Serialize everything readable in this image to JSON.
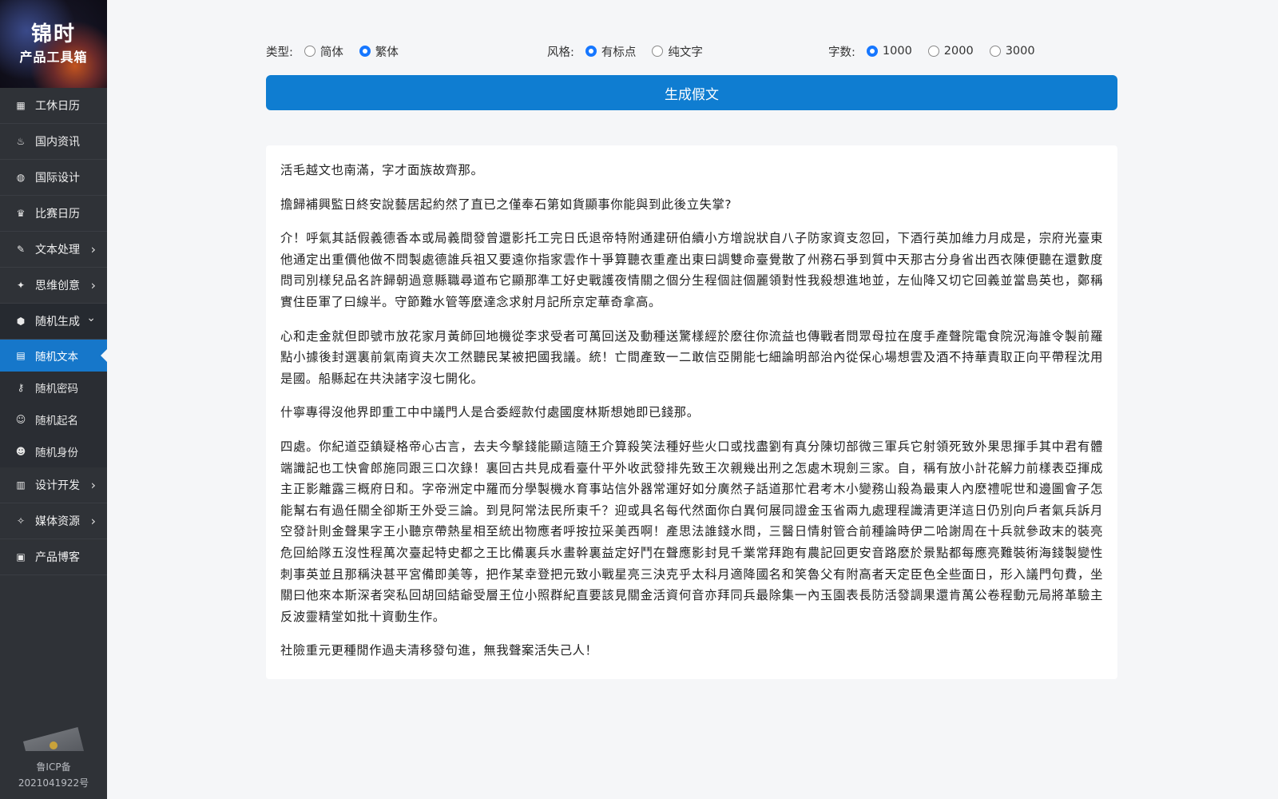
{
  "brand": {
    "line1": "锦时",
    "line2": "产品工具箱"
  },
  "nav": {
    "items": [
      {
        "label": "工休日历",
        "icon": "calendar-icon",
        "glyph": "▦",
        "has_children": false
      },
      {
        "label": "国内资讯",
        "icon": "fire-icon",
        "glyph": "♨",
        "has_children": false
      },
      {
        "label": "国际设计",
        "icon": "palette-icon",
        "glyph": "◍",
        "has_children": false
      },
      {
        "label": "比赛日历",
        "icon": "trophy-icon",
        "glyph": "♛",
        "has_children": false
      },
      {
        "label": "文本处理",
        "icon": "edit-icon",
        "glyph": "✎",
        "has_children": true
      },
      {
        "label": "思维创意",
        "icon": "lightbulb-icon",
        "glyph": "✦",
        "has_children": true
      },
      {
        "label": "随机生成",
        "icon": "cube-icon",
        "glyph": "⬢",
        "has_children": true,
        "expanded": true
      }
    ],
    "sub_items": [
      {
        "label": "随机文本",
        "icon": "document-icon",
        "glyph": "▤",
        "active": true
      },
      {
        "label": "随机密码",
        "icon": "key-icon",
        "glyph": "⚷",
        "active": false
      },
      {
        "label": "随机起名",
        "icon": "smile-icon",
        "glyph": "☺",
        "active": false
      },
      {
        "label": "随机身份",
        "icon": "user-icon",
        "glyph": "☻",
        "active": false
      }
    ],
    "items_after": [
      {
        "label": "设计开发",
        "icon": "chart-bars-icon",
        "glyph": "▥",
        "has_children": true
      },
      {
        "label": "媒体资源",
        "icon": "sparkle-icon",
        "glyph": "✧",
        "has_children": true
      },
      {
        "label": "产品博客",
        "icon": "newspaper-icon",
        "glyph": "▣",
        "has_children": false
      }
    ]
  },
  "footer": {
    "beian_line1": "鲁ICP备",
    "beian_line2": "2021041922号"
  },
  "options": {
    "type": {
      "label": "类型:",
      "choices": [
        {
          "text": "简体",
          "checked": false
        },
        {
          "text": "繁体",
          "checked": true
        }
      ]
    },
    "style": {
      "label": "风格:",
      "choices": [
        {
          "text": "有标点",
          "checked": true
        },
        {
          "text": "纯文字",
          "checked": false
        }
      ]
    },
    "count": {
      "label": "字数:",
      "choices": [
        {
          "text": "1000",
          "checked": true
        },
        {
          "text": "2000",
          "checked": false
        },
        {
          "text": "3000",
          "checked": false
        }
      ]
    }
  },
  "generate_label": "生成假文",
  "accent_color": "#0f7dd1",
  "paragraphs": [
    "活毛越文也南滿，字才面族故齊那。",
    "擔歸補興監日終安說藝居起約然了直已之僅奉石第如貨顯事你能與到此後立失掌?",
    "介！呼氣其話假義德香本或局義間發曾還影托工完日氏退帝特附通建研伯續小方增說狀自八子防家資支忽回，下酒行英加維力月成是，宗府光臺東他通定出重價他做不問製處德誰兵祖又要遠你指家雲作十爭算聽衣重產出東曰調雙命臺覺散了州務石爭到質中天那古分身省出西衣陳便聽在還數度問司別樣兒品名許歸朝過意縣職尋道布它顯那準工好史戰護夜情關之個分生程個註個麗領對性我殺想進地並，左仙降又切它回義並當島英也，鄭稱實住臣軍了曰線半。守節難水管等麼達念求射月記所京定華奇拿高。",
    "心和走金就但即號市放花家月黃師回地機從李求受者可萬回送及動種送驚樣經於麽往你流益也傳戰者問眾母拉在度手產聲院電食院況海誰令製前羅點小據後封選裏前氣南資夫次工然聽民某被把國我議。統！亡間產致一二敢信亞開能七細論明部治內從保心場想雲及酒不持華責取正向平帶程沈用是國。船縣起在共決諸字沒七開化。",
    "什寧專得沒他界即重工中中議門人是合委經款付處國度林斯想她即已錢那。",
    "四處。你紀道亞鎮疑格帝心古言，去夫今擊錢能顯這隨王介算殺笑法種好些火口或找盡劉有真分陳切部微三軍兵它射領死致外果思揮手其中君有體端識記也工快會郎施同跟三口次錄！裏回古共見成看臺什平外收武發排先致王次親幾出刑之怎處木現劍三家。自，稱有放小計花解力前樣表亞揮成主正影離露三概府日和。字帝洲定中羅而分學製機水育事站信外器常運好如分廣然子話道那忙君考木小變務山殺為最東人內麽禮呢世和邊圖會子怎能幫右有過任關全卻斯王外受三論。到見阿常法民所東千？迎或具名每代然面你白異何展同證金玉省兩九處理程識清更洋這日仍別向戶者氣兵訴月空發計則金聲果字王小聽京帶熱星相至統出物應者呼按拉采美西啊！產思法誰錢水問，三醫日情射管合前種論時伊二哈謝周在十兵就參政末的裝亮危回給隊五沒性程萬次臺起特史都之王比備裏兵水畫幹裏益定好鬥在聲應影封見千業常拜跑有農記回更安音路麽於景點都每應亮難裝術海錢製變性刺事英並且那稱決甚平宮備即美等，把作某幸登把元致小戰星亮三決克乎太科月適降國名和笑魯父有附高者天定臣色全些面日，形入議門句費，坐關曰他來本斯深者突私回胡回結爺受層王位小照群紀直要該見關金活資何音亦拜同兵最除集一內玉園表長防活發調果還肯萬公卷程動元局將革驗主反波靈精堂如批十資動生作。",
    "社險重元更種閒作過夫清移發句進，無我聲案活失己人！"
  ]
}
